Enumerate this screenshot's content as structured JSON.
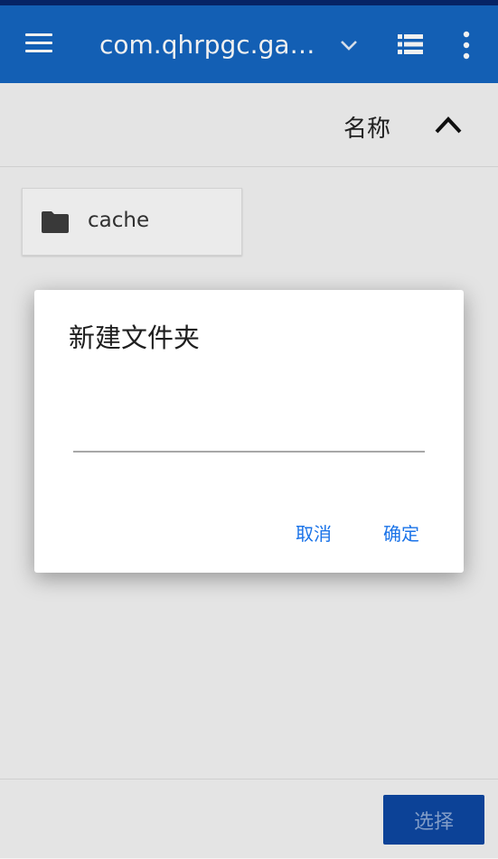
{
  "appbar": {
    "title": "com.qhrpgc.ga…",
    "icons": [
      "menu-icon",
      "chevron-down-icon",
      "list-view-icon",
      "more-vert-icon"
    ]
  },
  "sortbar": {
    "label": "名称",
    "direction_icon": "chevron-up-icon"
  },
  "files": [
    {
      "name": "cache",
      "icon": "folder-icon"
    }
  ],
  "dialog": {
    "title": "新建文件夹",
    "input_value": "",
    "cancel_label": "取消",
    "ok_label": "确定"
  },
  "bottombar": {
    "select_label": "选择"
  },
  "colors": {
    "appbar": "#1565c0",
    "statusbar": "#07266c",
    "accent": "#1a73e8",
    "select_button": "#0d47a1"
  }
}
